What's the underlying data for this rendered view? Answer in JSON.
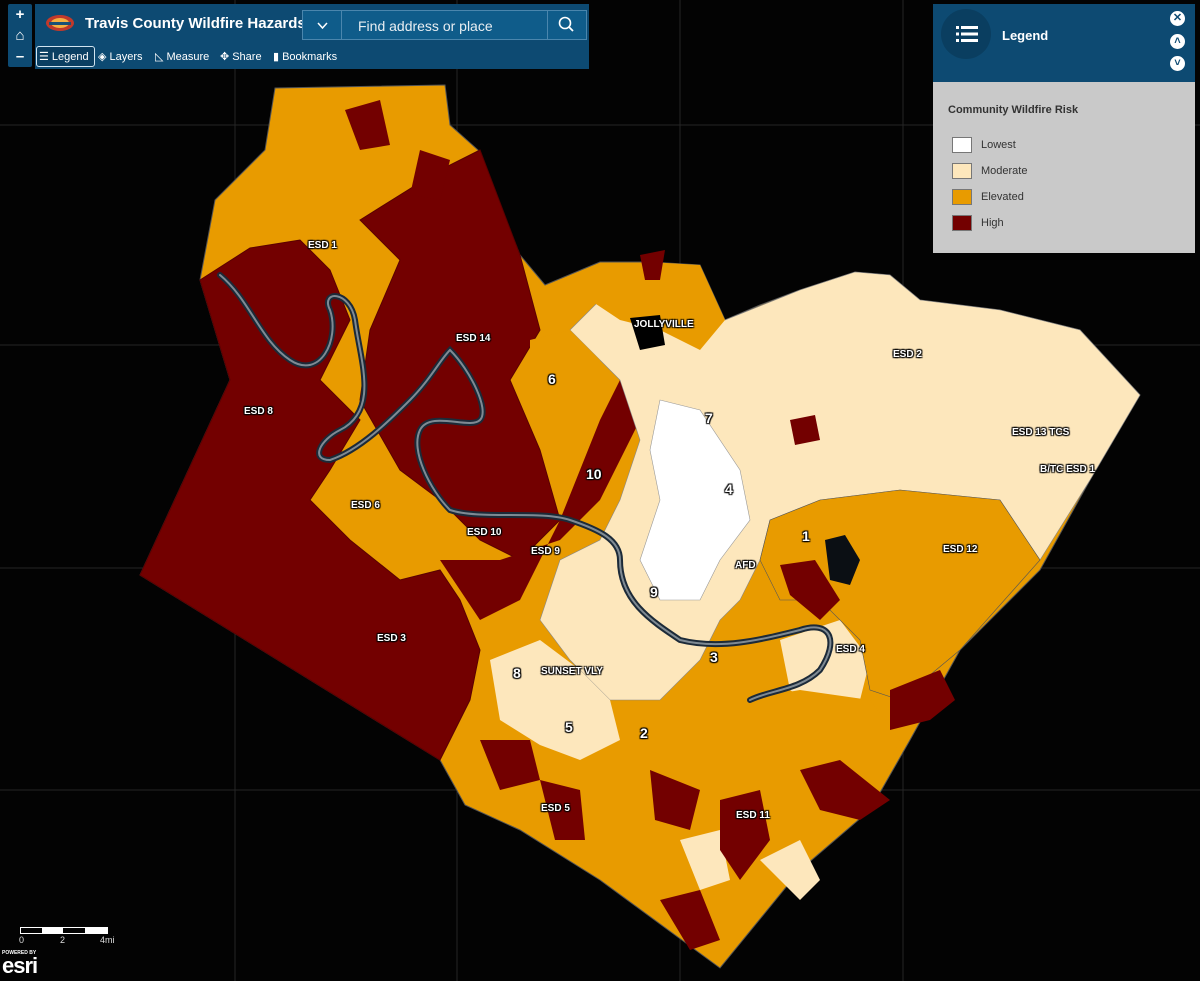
{
  "app": {
    "title": "Travis County Wildfire Hazards"
  },
  "zoom": {
    "in": "+",
    "home": "⌂",
    "out": "–"
  },
  "search": {
    "placeholder": "Find address or place"
  },
  "toolbar": {
    "legend": "Legend",
    "layers": "Layers",
    "measure": "Measure",
    "share": "Share",
    "bookmarks": "Bookmarks"
  },
  "legend_panel": {
    "title": "Legend",
    "layer_title": "Community Wildfire Risk",
    "items": [
      {
        "label": "Lowest",
        "color": "#ffffff"
      },
      {
        "label": "Moderate",
        "color": "#fde7bc"
      },
      {
        "label": "Elevated",
        "color": "#e89b00"
      },
      {
        "label": "High",
        "color": "#730000"
      }
    ]
  },
  "scale": {
    "l0": "0",
    "l1": "2",
    "l2": "4mi"
  },
  "attribution": {
    "powered": "POWERED BY",
    "brand": "esri"
  },
  "map_labels": {
    "esd1": "ESD 1",
    "esd14": "ESD 14",
    "esd8": "ESD 8",
    "esd6": "ESD 6",
    "esd10": "ESD 10",
    "esd9": "ESD 9",
    "esd3": "ESD 3",
    "esd5": "ESD 5",
    "esd11": "ESD 11",
    "esd4": "ESD 4",
    "esd12": "ESD 12",
    "esd2": "ESD 2",
    "esd13": "ESD 13 TCS",
    "btc": "B/TC ESD 1",
    "jolly": "JOLLYVILLE",
    "afd": "AFD",
    "sunset": "SUNSET VLY",
    "n6": "6",
    "n7": "7",
    "n10": "10",
    "n4": "4",
    "n1": "1",
    "n9": "9",
    "n3": "3",
    "n8": "8",
    "n5": "5",
    "n2": "2"
  }
}
